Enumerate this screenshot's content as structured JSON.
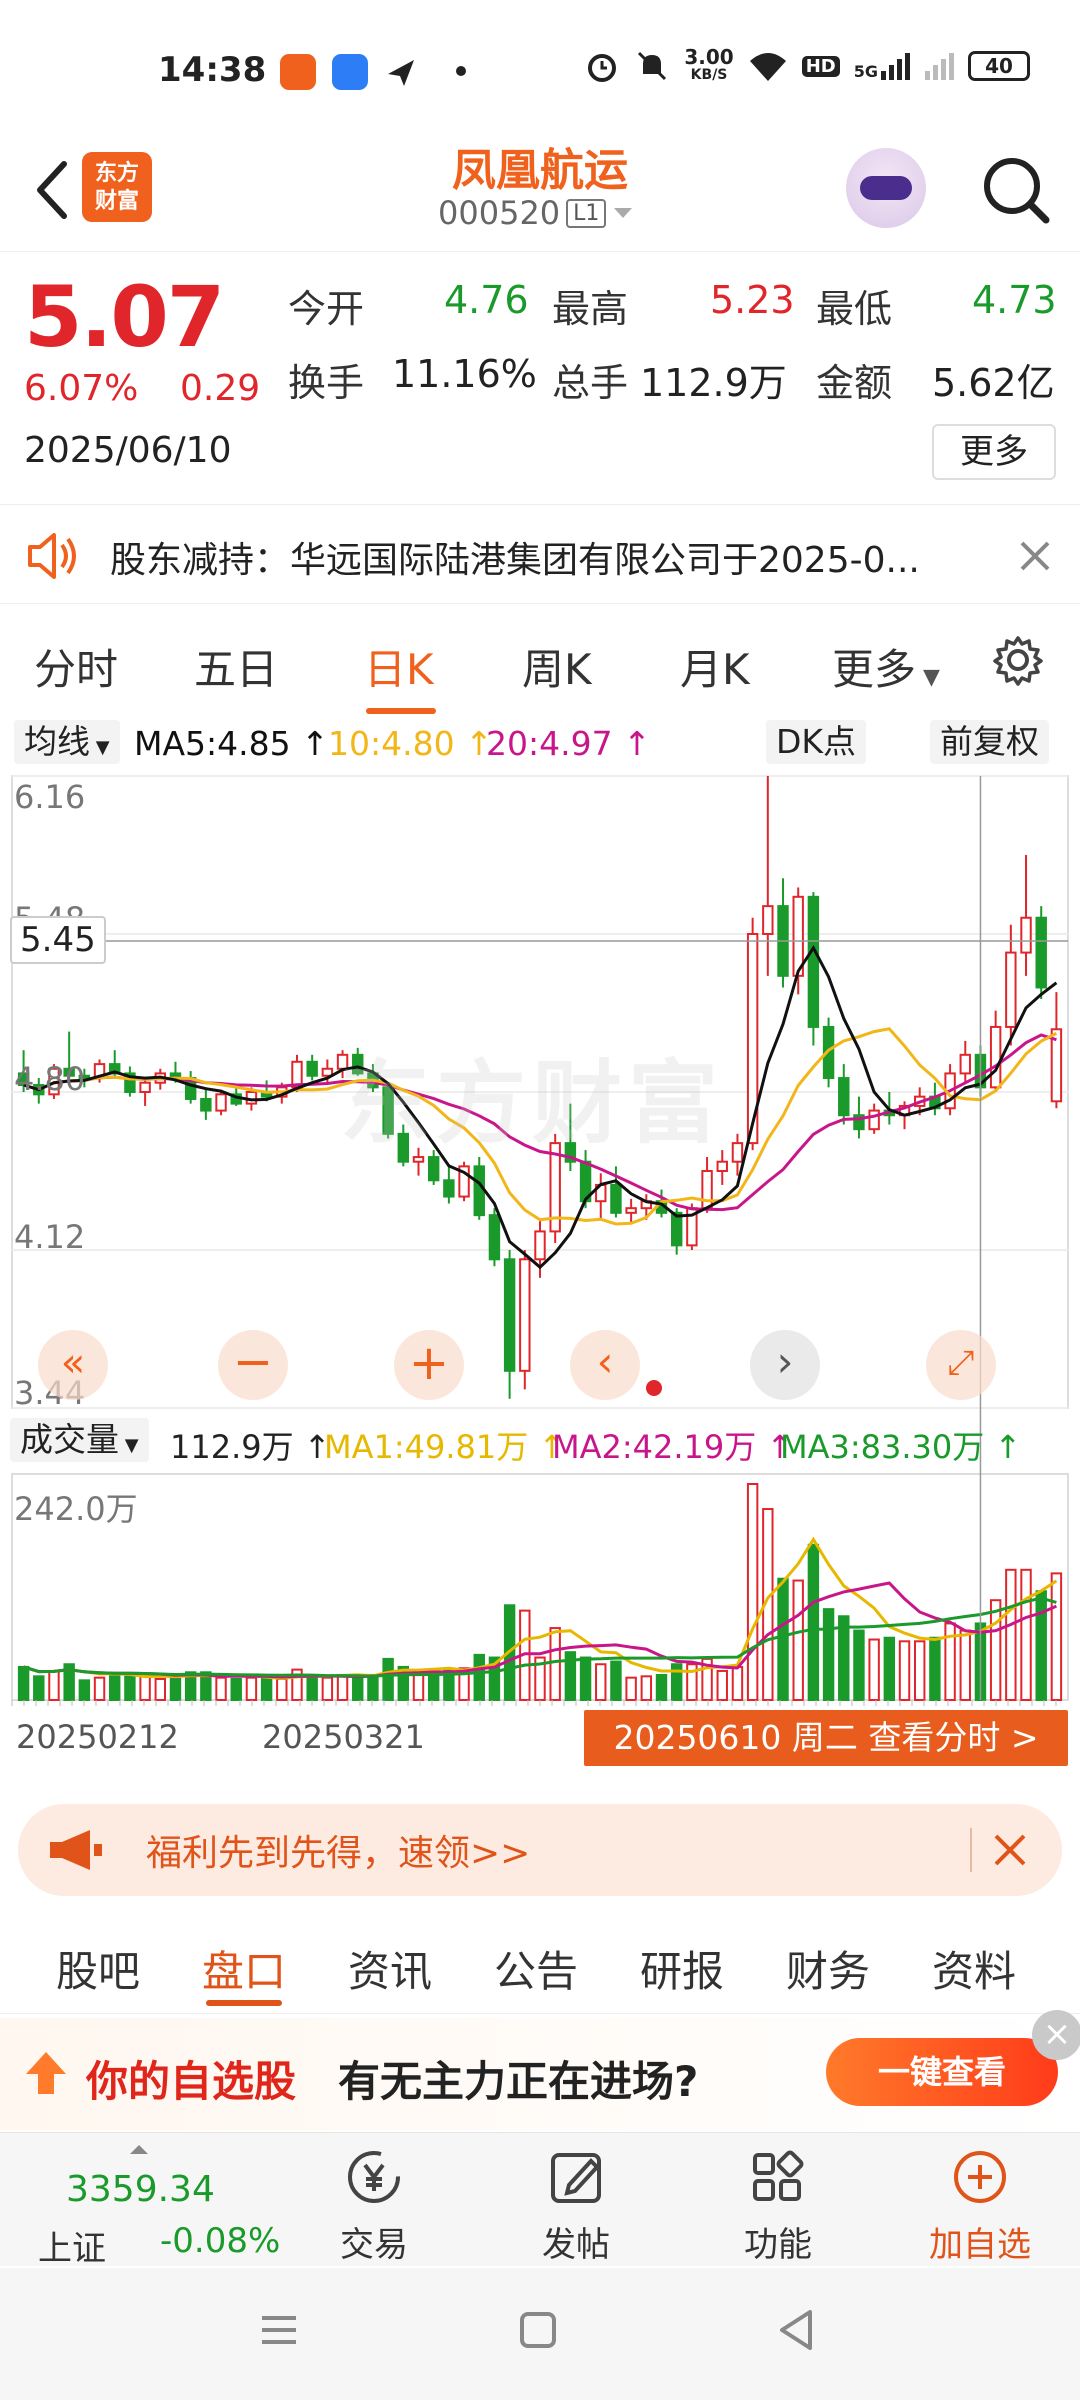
{
  "status_bar": {
    "time": "14:38",
    "net_speed": "3.00",
    "net_speed_unit": "KB/S",
    "hd": "HD",
    "net_type": "5G",
    "battery": "40"
  },
  "header": {
    "logo_text_1": "东方",
    "logo_text_2": "财富",
    "stock_name": "凤凰航运",
    "stock_code": "000520",
    "market_badge": "L1"
  },
  "quote": {
    "price": "5.07",
    "change_pct": "6.07%",
    "change": "0.29",
    "date": "2025/06/10",
    "open_label": "今开",
    "open": "4.76",
    "high_label": "最高",
    "high": "5.23",
    "low_label": "最低",
    "low": "4.73",
    "turnover_label": "换手",
    "turnover": "11.16%",
    "volume_label": "总手",
    "volume": "112.9万",
    "amount_label": "金额",
    "amount": "5.62亿",
    "more_button": "更多"
  },
  "notice": {
    "text": "股东减持：华远国际陆港集团有限公司于2025-0..."
  },
  "period_tabs": [
    "分时",
    "五日",
    "日K",
    "周K",
    "月K",
    "更多"
  ],
  "active_period": "日K",
  "ma_legend": {
    "selector": "均线",
    "ma5": "MA5:4.85",
    "ma10": "10:4.80",
    "ma20": "20:4.97",
    "dk_button": "DK点",
    "adjust_button": "前复权"
  },
  "price_axis": {
    "top": "6.16",
    "mid_high": "5.48",
    "mid": "4.80",
    "mid_low": "4.12",
    "bottom": "3.44",
    "crosshair_price": "5.45"
  },
  "volume_legend": {
    "selector": "成交量",
    "vol": "112.9万",
    "ma1": "MA1:49.81万",
    "ma2": "MA2:42.19万",
    "ma3": "MA3:83.30万",
    "axis_top": "242.0万"
  },
  "date_axis": {
    "d1": "20250212",
    "d2": "20250321",
    "crosshair_label": "20250610 周二 查看分时 >"
  },
  "watermark": "东方财富",
  "banner": {
    "text": "福利先到先得，速领>>"
  },
  "bottom_tabs": [
    "股吧",
    "盘口",
    "资讯",
    "公告",
    "研报",
    "财务",
    "资料"
  ],
  "active_bottom_tab": "盘口",
  "promo": {
    "text_highlight": "你的自选股",
    "text_rest": "有无主力正在进场?",
    "button": "一键查看"
  },
  "bottom_nav": {
    "index_value": "3359.34",
    "index_name": "上证",
    "index_change": "-0.08%",
    "items": [
      "交易",
      "发帖",
      "功能",
      "加自选"
    ]
  },
  "colors": {
    "up": "#e0262b",
    "down": "#1a9a2a",
    "accent": "#f0611d",
    "ma5": "#111111",
    "ma10": "#f2b619",
    "ma20": "#c8168a"
  },
  "chart_data": {
    "type": "candlestick",
    "title": "",
    "ylim": [
      3.44,
      6.16
    ],
    "y_ticks": [
      6.16,
      5.48,
      4.8,
      4.12,
      3.44
    ],
    "x_tick_labels": [
      "20250212",
      "20250321"
    ],
    "last_date": "20250610",
    "series": [
      {
        "name": "K",
        "ohlc": [
          [
            4.88,
            4.98,
            4.8,
            4.83
          ],
          [
            4.83,
            4.86,
            4.75,
            4.79
          ],
          [
            4.79,
            4.92,
            4.77,
            4.9
          ],
          [
            4.9,
            5.06,
            4.86,
            4.87
          ],
          [
            4.87,
            4.9,
            4.82,
            4.86
          ],
          [
            4.86,
            4.94,
            4.84,
            4.92
          ],
          [
            4.92,
            4.98,
            4.87,
            4.88
          ],
          [
            4.88,
            4.91,
            4.78,
            4.8
          ],
          [
            4.8,
            4.86,
            4.74,
            4.84
          ],
          [
            4.84,
            4.9,
            4.81,
            4.88
          ],
          [
            4.88,
            4.93,
            4.84,
            4.86
          ],
          [
            4.86,
            4.89,
            4.75,
            4.77
          ],
          [
            4.77,
            4.82,
            4.68,
            4.72
          ],
          [
            4.72,
            4.8,
            4.7,
            4.79
          ],
          [
            4.79,
            4.83,
            4.74,
            4.75
          ],
          [
            4.75,
            4.82,
            4.72,
            4.8
          ],
          [
            4.8,
            4.85,
            4.76,
            4.78
          ],
          [
            4.78,
            4.84,
            4.75,
            4.82
          ],
          [
            4.82,
            4.96,
            4.8,
            4.93
          ],
          [
            4.93,
            4.96,
            4.85,
            4.87
          ],
          [
            4.87,
            4.94,
            4.84,
            4.9
          ],
          [
            4.9,
            4.98,
            4.86,
            4.96
          ],
          [
            4.96,
            4.99,
            4.87,
            4.88
          ],
          [
            4.88,
            4.92,
            4.8,
            4.82
          ],
          [
            4.82,
            4.84,
            4.6,
            4.62
          ],
          [
            4.62,
            4.66,
            4.48,
            4.5
          ],
          [
            4.5,
            4.56,
            4.44,
            4.52
          ],
          [
            4.52,
            4.55,
            4.4,
            4.42
          ],
          [
            4.42,
            4.48,
            4.32,
            4.35
          ],
          [
            4.35,
            4.5,
            4.33,
            4.48
          ],
          [
            4.48,
            4.52,
            4.25,
            4.27
          ],
          [
            4.27,
            4.3,
            4.05,
            4.08
          ],
          [
            4.08,
            4.12,
            3.48,
            3.6
          ],
          [
            3.6,
            4.12,
            3.52,
            4.08
          ],
          [
            4.08,
            4.25,
            4.0,
            4.2
          ],
          [
            4.2,
            4.62,
            4.15,
            4.58
          ],
          [
            4.58,
            4.75,
            4.46,
            4.5
          ],
          [
            4.5,
            4.55,
            4.3,
            4.33
          ],
          [
            4.33,
            4.45,
            4.25,
            4.4
          ],
          [
            4.4,
            4.48,
            4.26,
            4.28
          ],
          [
            4.28,
            4.34,
            4.24,
            4.3
          ],
          [
            4.3,
            4.36,
            4.25,
            4.33
          ],
          [
            4.33,
            4.38,
            4.26,
            4.28
          ],
          [
            4.28,
            4.3,
            4.1,
            4.14
          ],
          [
            4.14,
            4.32,
            4.12,
            4.3
          ],
          [
            4.3,
            4.52,
            4.28,
            4.46
          ],
          [
            4.46,
            4.55,
            4.4,
            4.5
          ],
          [
            4.5,
            4.62,
            4.44,
            4.58
          ],
          [
            4.58,
            5.55,
            4.55,
            5.48
          ],
          [
            5.48,
            6.16,
            5.3,
            5.6
          ],
          [
            5.6,
            5.72,
            5.25,
            5.3
          ],
          [
            5.3,
            5.68,
            5.22,
            5.64
          ],
          [
            5.64,
            5.66,
            5.0,
            5.08
          ],
          [
            5.08,
            5.12,
            4.82,
            4.86
          ],
          [
            4.86,
            4.92,
            4.66,
            4.7
          ],
          [
            4.7,
            4.78,
            4.6,
            4.64
          ],
          [
            4.64,
            4.75,
            4.62,
            4.72
          ],
          [
            4.72,
            4.8,
            4.66,
            4.7
          ],
          [
            4.7,
            4.76,
            4.64,
            4.74
          ],
          [
            4.74,
            4.82,
            4.7,
            4.78
          ],
          [
            4.78,
            4.84,
            4.7,
            4.73
          ],
          [
            4.73,
            4.92,
            4.7,
            4.88
          ],
          [
            4.88,
            5.02,
            4.84,
            4.96
          ],
          [
            4.96,
            5.0,
            4.78,
            4.82
          ],
          [
            4.82,
            5.15,
            4.8,
            5.08
          ],
          [
            5.08,
            5.52,
            5.0,
            5.4
          ],
          [
            5.4,
            5.82,
            5.3,
            5.55
          ],
          [
            5.55,
            5.6,
            5.2,
            5.25
          ],
          [
            4.76,
            5.23,
            4.73,
            5.07
          ]
        ]
      },
      {
        "name": "MA5",
        "last": 4.85
      },
      {
        "name": "MA10",
        "last": 4.8
      },
      {
        "name": "MA20",
        "last": 4.97
      }
    ],
    "volume": {
      "ylim_top": "242.0万",
      "last": "112.9万"
    }
  }
}
